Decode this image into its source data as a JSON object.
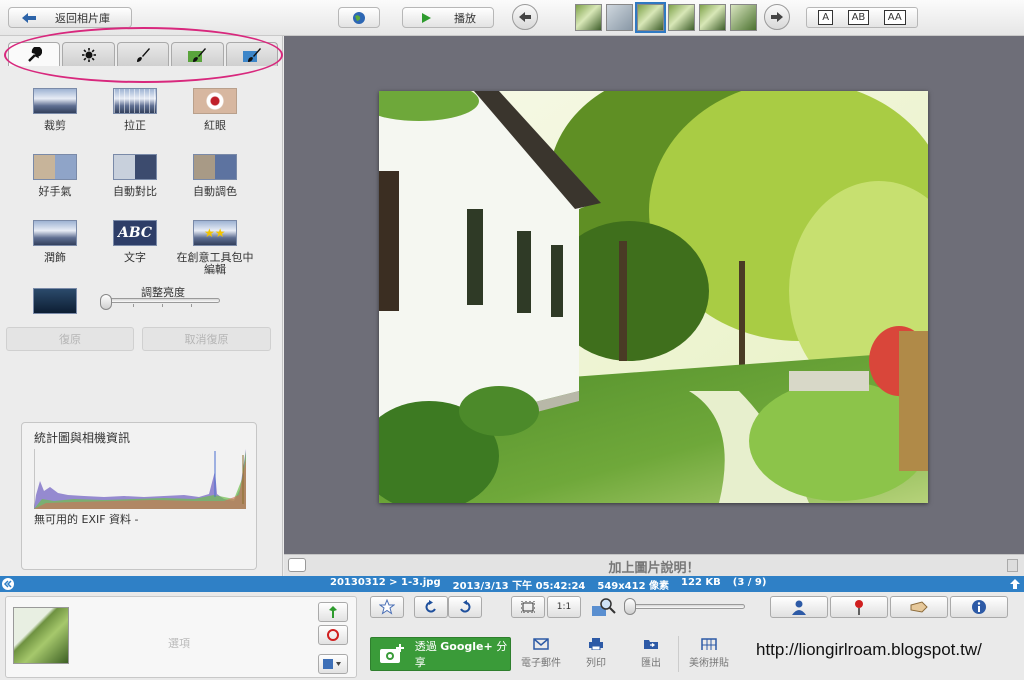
{
  "toolbar": {
    "back_label": "返回相片庫",
    "play_label": "播放",
    "view_modes": [
      "A",
      "AB",
      "AA"
    ],
    "thumb_count": 6,
    "selected_thumb": 2
  },
  "edit_tabs": [
    "wrench-icon",
    "brightness-icon",
    "brush-icon",
    "green-brush-icon",
    "blue-brush-icon"
  ],
  "tools": [
    {
      "label": "裁剪",
      "icon": "crop-icon"
    },
    {
      "label": "拉正",
      "icon": "straighten-icon"
    },
    {
      "label": "紅眼",
      "icon": "redeye-icon"
    },
    {
      "label": "好手氣",
      "icon": "lucky-icon"
    },
    {
      "label": "自動對比",
      "icon": "auto-contrast-icon"
    },
    {
      "label": "自動調色",
      "icon": "auto-color-icon"
    },
    {
      "label": "潤飾",
      "icon": "retouch-icon"
    },
    {
      "label": "文字",
      "icon": "text-icon"
    },
    {
      "label": "在創意工具包中編輯",
      "icon": "creative-kit-icon"
    }
  ],
  "brightness": {
    "label": "調整亮度",
    "value": 0
  },
  "undo_label": "復原",
  "redo_label": "取消復原",
  "histogram": {
    "title": "統計圖與相機資訊",
    "exif_note": "無可用的 EXIF 資料 -"
  },
  "caption_placeholder": "加上圖片說明！",
  "info": {
    "path": "20130312 > 1-3.jpg",
    "date": "2013/3/13",
    "time_prefix": "下午",
    "time": "05:42:24",
    "dimensions": "549x412",
    "dim_unit": "像素",
    "size": "122 KB",
    "index": "(3 / 9)"
  },
  "tray": {
    "label": "選項"
  },
  "actions": {
    "share_prefix": "透過",
    "share_brand": "Google+",
    "share_suffix": "分享",
    "email": "電子郵件",
    "print": "列印",
    "export": "匯出",
    "collage": "美術拼貼"
  },
  "zoom": {
    "fit_label": "1:1"
  },
  "watermark_url": "http://liongirlroam.blogspot.tw/",
  "colors": {
    "accent": "#2f80c6",
    "share_green": "#3a9b39",
    "annotation": "#d8287d"
  }
}
